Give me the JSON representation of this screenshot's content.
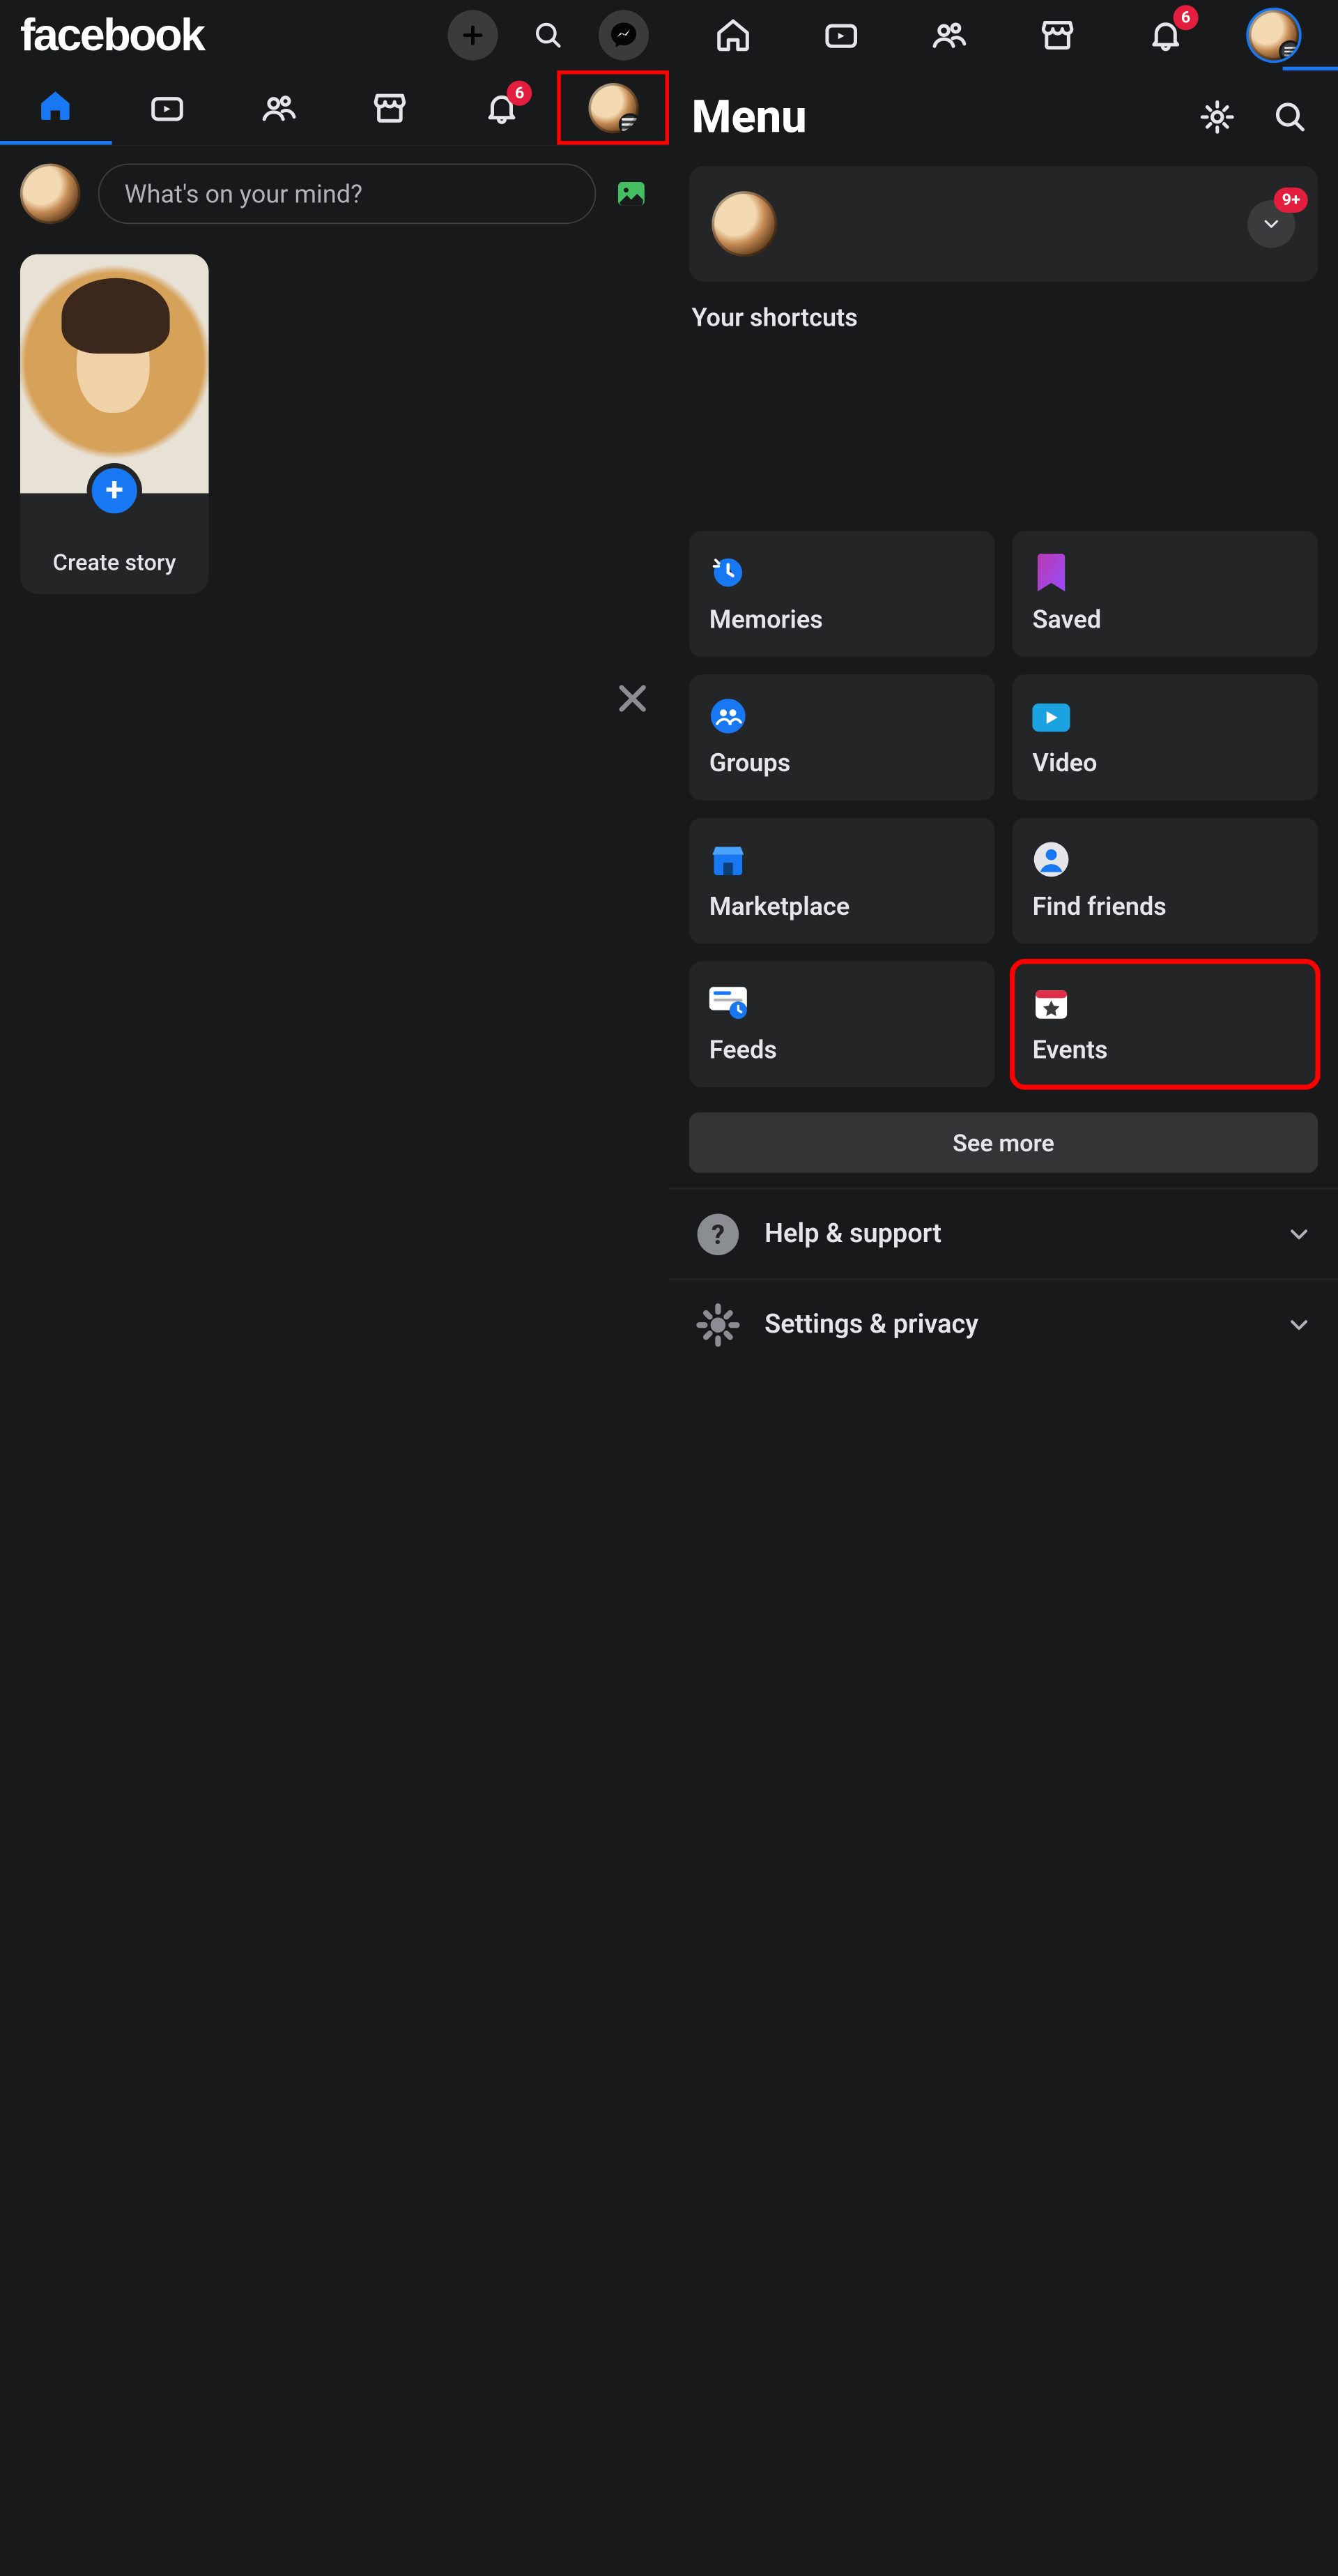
{
  "brand": "facebook",
  "left": {
    "topbar": {
      "icons": [
        "plus",
        "search",
        "messenger"
      ]
    },
    "tabs": {
      "notification_badge": "6",
      "items": [
        "home",
        "video",
        "friends",
        "marketplace",
        "notifications",
        "profile-menu"
      ]
    },
    "composer": {
      "placeholder": "What's on your mind?"
    },
    "story": {
      "label": "Create story"
    }
  },
  "right": {
    "topbar": {
      "icons": [
        "home",
        "video",
        "friends",
        "marketplace",
        "notifications",
        "profile-menu"
      ],
      "notification_badge": "6"
    },
    "menu_title": "Menu",
    "profile_badge": "9+",
    "shortcuts_label": "Your shortcuts",
    "tiles": [
      {
        "key": "memories",
        "label": "Memories"
      },
      {
        "key": "saved",
        "label": "Saved"
      },
      {
        "key": "groups",
        "label": "Groups"
      },
      {
        "key": "video",
        "label": "Video"
      },
      {
        "key": "marketplace",
        "label": "Marketplace"
      },
      {
        "key": "find",
        "label": "Find friends"
      },
      {
        "key": "feeds",
        "label": "Feeds"
      },
      {
        "key": "events",
        "label": "Events"
      }
    ],
    "see_more": "See more",
    "rows": [
      {
        "key": "help",
        "label": "Help & support"
      },
      {
        "key": "settings",
        "label": "Settings & privacy"
      }
    ]
  }
}
